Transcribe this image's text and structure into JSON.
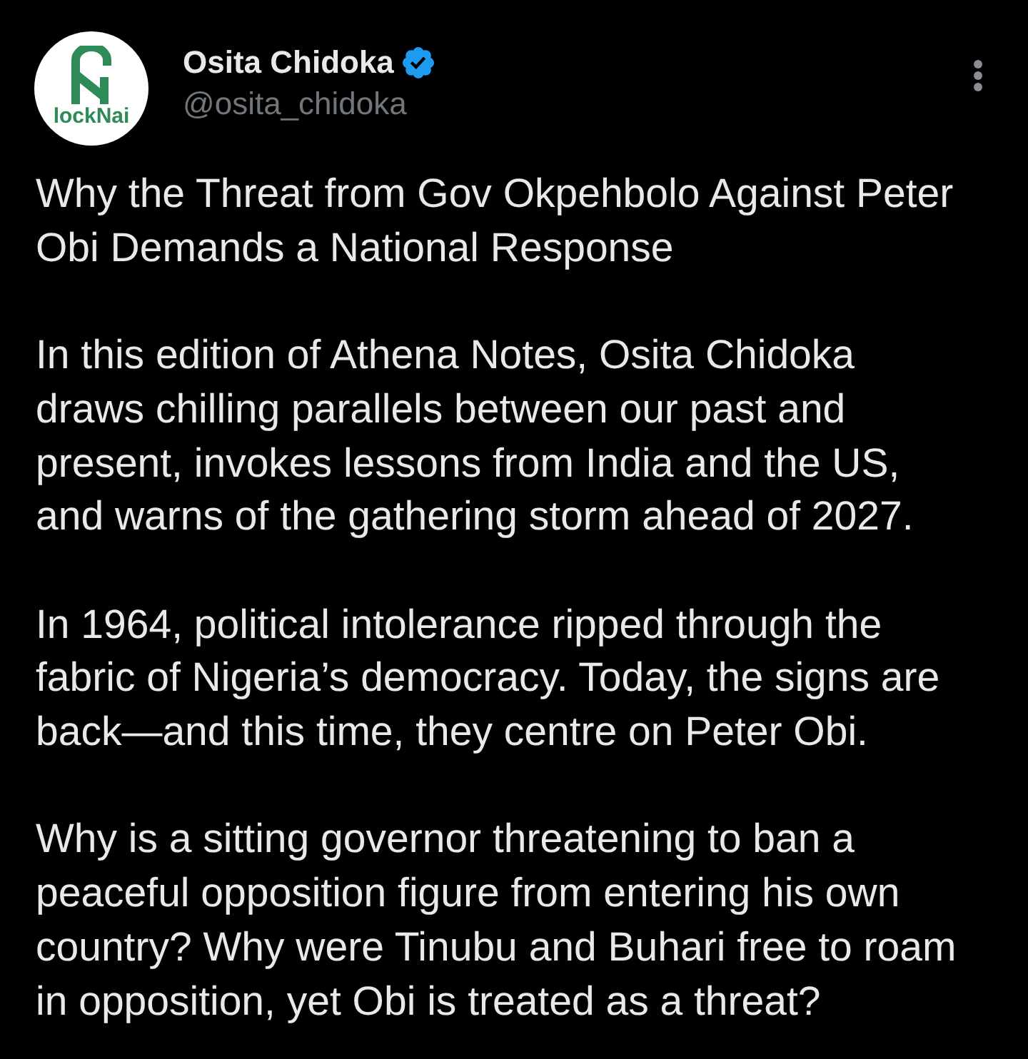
{
  "author": {
    "name": "Osita Chidoka",
    "handle": "@osita_chidoka",
    "verified": true,
    "avatar_text": "lockNai"
  },
  "post": {
    "paragraphs": [
      "Why the Threat from Gov Okpehbolo Against Peter Obi Demands a National Response",
      "In this edition of Athena Notes, Osita Chidoka draws chilling parallels between our past and present, invokes lessons from India and the US, and warns of the gathering storm ahead of 2027.",
      "In 1964, political intolerance ripped through the fabric of Nigeria’s democracy. Today, the signs are back—and this time, they centre on Peter Obi.",
      "Why is a sitting governor threatening to ban a peaceful opposition figure from entering his own country? Why were Tinubu and Buhari free to roam in opposition, yet Obi is treated as a threat?"
    ]
  }
}
